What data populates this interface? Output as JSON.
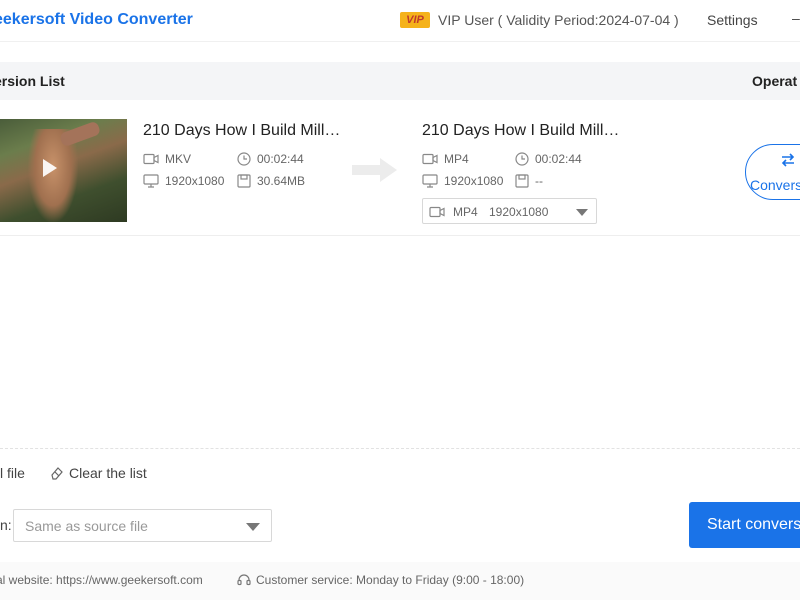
{
  "titlebar": {
    "app_title": "eekersoft Video Converter",
    "vip_badge": "VIP",
    "vip_user": "VIP User ( Validity Period:2024-07-04 )",
    "settings": "Settings",
    "minimize": "–"
  },
  "list": {
    "title": "ersion List",
    "operate": "Operat"
  },
  "file": {
    "source": {
      "name": "210 Days How I Build Mill…",
      "format": "MKV",
      "duration": "00:02:44",
      "resolution": "1920x1080",
      "size": "30.64MB"
    },
    "target": {
      "name": "210 Days How I Build Mill…",
      "format": "MP4",
      "duration": "00:02:44",
      "resolution": "1920x1080",
      "size": "--"
    },
    "format_select": {
      "format": "MP4",
      "resolution": "1920x1080"
    },
    "convert_label": "Convers"
  },
  "toolbar": {
    "add_file": "l file",
    "clear_list": "Clear the list",
    "output_label": "n:",
    "output_value": "Same as source file",
    "start_button": "Start convers"
  },
  "footer": {
    "website": "al website: https://www.geekersoft.com",
    "service": "Customer service: Monday to Friday (9:00 - 18:00)"
  },
  "colors": {
    "accent": "#1a73e8",
    "vip": "#f5b21b"
  }
}
